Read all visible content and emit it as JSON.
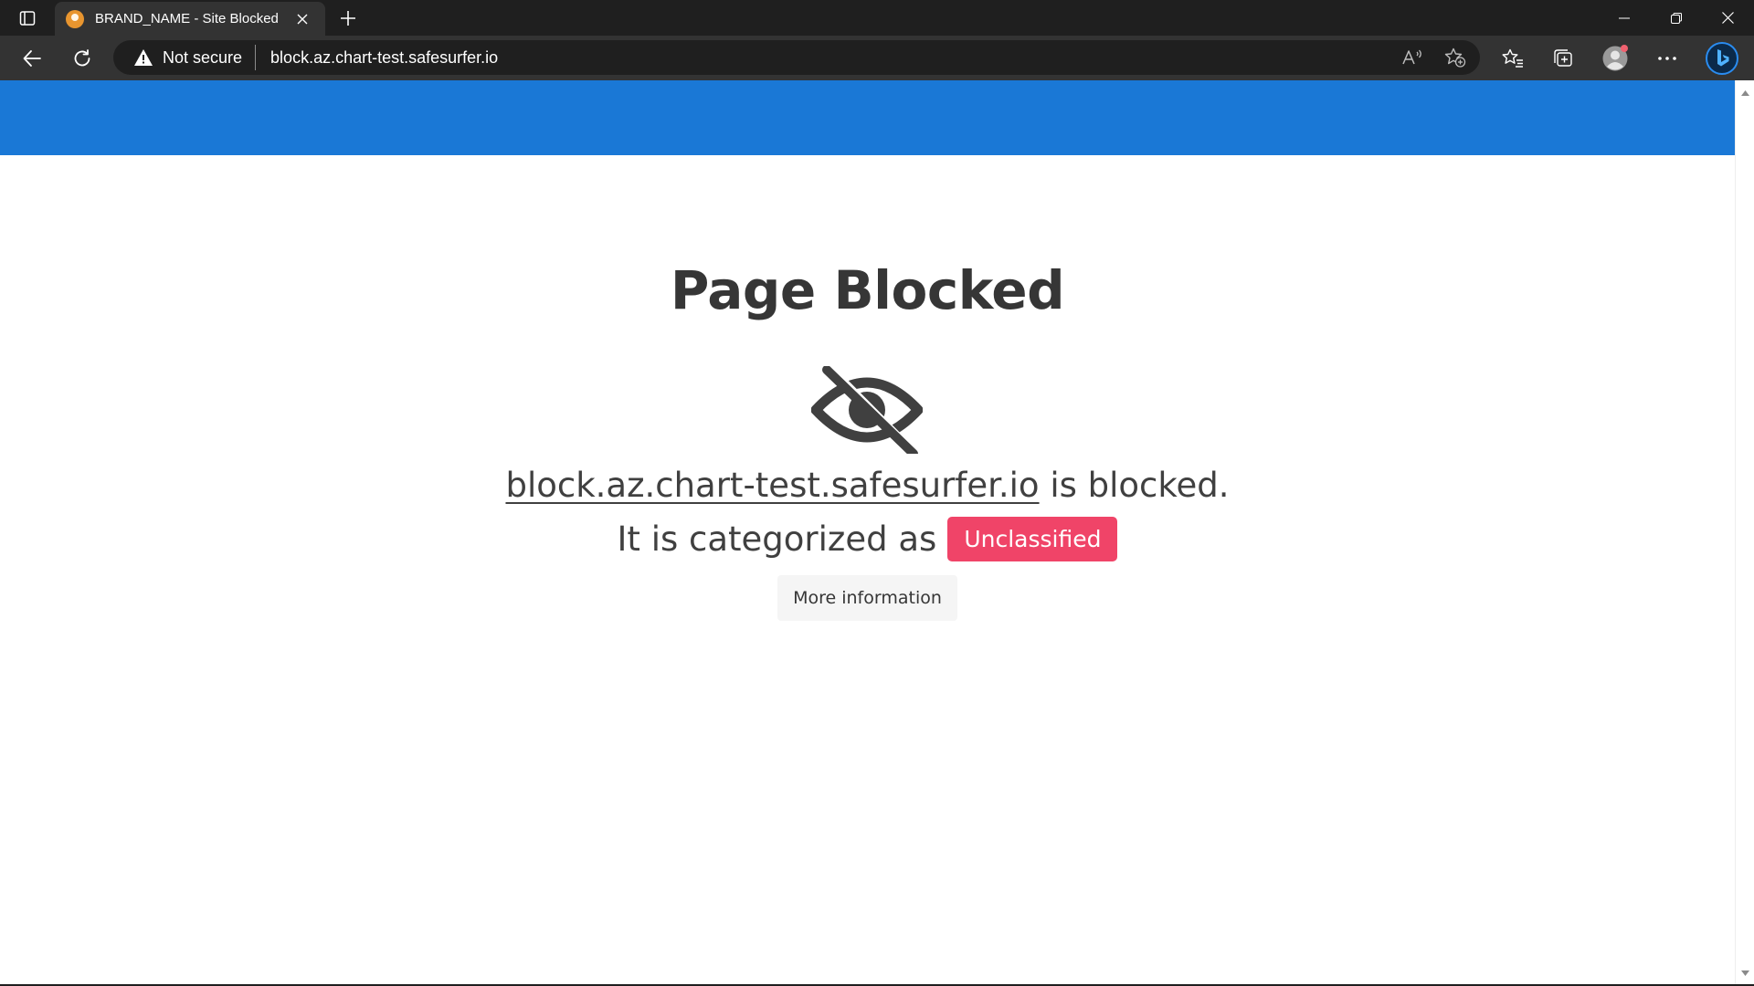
{
  "browser": {
    "tab": {
      "title": "BRAND_NAME - Site Blocked",
      "favicon": "site-favicon"
    },
    "address_bar": {
      "security_label": "Not secure",
      "url": "block.az.chart-test.safesurfer.io"
    },
    "toolbar_icons": [
      "back-icon",
      "refresh-icon",
      "read-aloud-icon",
      "add-favorite-icon",
      "favorites-icon",
      "collections-icon",
      "profile-icon",
      "more-icon",
      "bing-icon"
    ],
    "window_controls": [
      "minimize-icon",
      "restore-icon",
      "close-icon"
    ]
  },
  "page": {
    "title": "Page Blocked",
    "icon": "eye-slash-icon",
    "blocked_domain": "block.az.chart-test.safesurfer.io",
    "blocked_suffix": " is blocked.",
    "category_prefix": "It is categorized as",
    "category": "Unclassified",
    "more_info_label": "More information"
  },
  "colors": {
    "header_blue": "#1a78d6",
    "category_tag": "#f04468",
    "chrome_dark": "#1f1f1f",
    "chrome_toolbar": "#333333"
  }
}
